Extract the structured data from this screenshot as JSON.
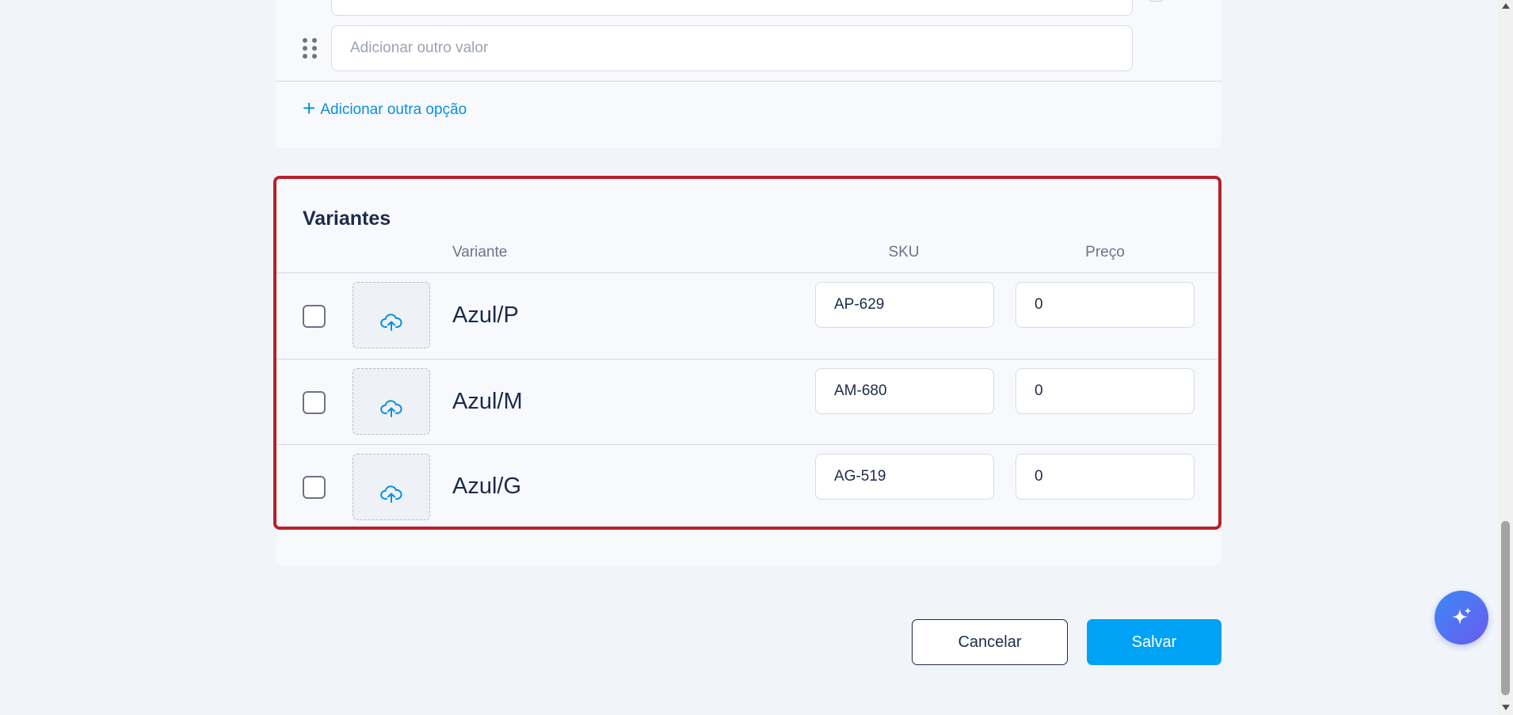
{
  "options": {
    "value_placeholder": "Adicionar outro valor",
    "add_option_label": "Adicionar outra opção"
  },
  "variants": {
    "title": "Variantes",
    "columns": {
      "variant": "Variante",
      "sku": "SKU",
      "price": "Preço"
    },
    "rows": [
      {
        "name": "Azul/P",
        "sku": "AP-629",
        "price": "0"
      },
      {
        "name": "Azul/M",
        "sku": "AM-680",
        "price": "0"
      },
      {
        "name": "Azul/G",
        "sku": "AG-519",
        "price": "0"
      }
    ]
  },
  "actions": {
    "cancel": "Cancelar",
    "save": "Salvar"
  },
  "icons": {
    "drag": "drag-handle-icon",
    "plus": "plus-icon",
    "upload": "cloud-upload-icon",
    "ai": "sparkles-icon"
  },
  "colors": {
    "accent": "#00a2f5",
    "link": "#0b8fe0",
    "highlight_border": "#b8202a",
    "text": "#1c2b4a"
  }
}
